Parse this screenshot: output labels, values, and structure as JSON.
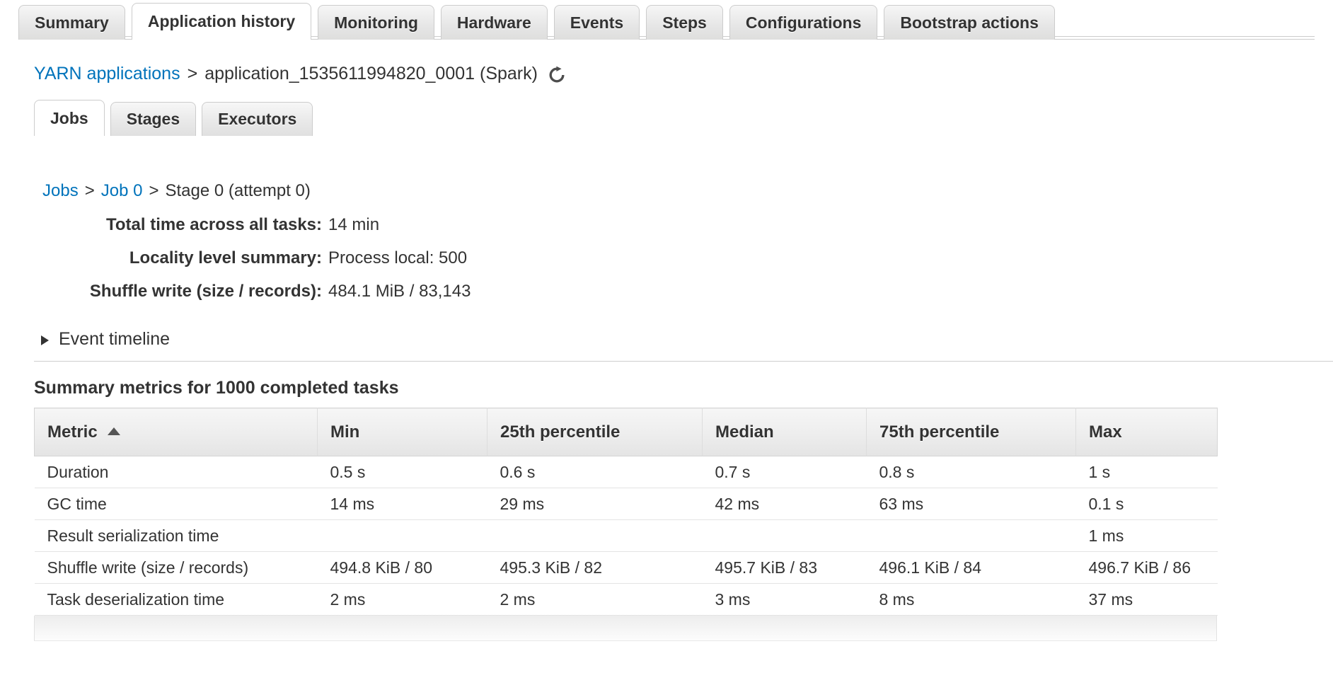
{
  "outer_tabs": [
    {
      "label": "Summary",
      "active": false
    },
    {
      "label": "Application history",
      "active": true
    },
    {
      "label": "Monitoring",
      "active": false
    },
    {
      "label": "Hardware",
      "active": false
    },
    {
      "label": "Events",
      "active": false
    },
    {
      "label": "Steps",
      "active": false
    },
    {
      "label": "Configurations",
      "active": false
    },
    {
      "label": "Bootstrap actions",
      "active": false
    }
  ],
  "app_breadcrumb": {
    "link_label": "YARN applications",
    "separator": ">",
    "current": "application_1535611994820_0001 (Spark)",
    "refresh_icon": "refresh-icon"
  },
  "inner_tabs": [
    {
      "label": "Jobs",
      "active": true
    },
    {
      "label": "Stages",
      "active": false
    },
    {
      "label": "Executors",
      "active": false
    }
  ],
  "job_breadcrumb": {
    "items": [
      {
        "label": "Jobs",
        "link": true
      },
      {
        "label": "Job 0",
        "link": true
      },
      {
        "label": "Stage 0 (attempt 0)",
        "link": false
      }
    ],
    "separator": ">"
  },
  "details": [
    {
      "label": "Total time across all tasks:",
      "value": "14 min"
    },
    {
      "label": "Locality level summary:",
      "value": "Process local: 500"
    },
    {
      "label": "Shuffle write (size / records):",
      "value": "484.1 MiB / 83,143"
    }
  ],
  "event_timeline": {
    "label": "Event timeline",
    "expand_icon": "triangle-right-icon",
    "expanded": false
  },
  "summary_heading": "Summary metrics for 1000 completed tasks",
  "metrics_table": {
    "sort_column": "Metric",
    "sort_direction": "asc",
    "sort_icon": "sort-ascending-icon",
    "columns": [
      "Metric",
      "Min",
      "25th percentile",
      "Median",
      "75th percentile",
      "Max"
    ],
    "rows": [
      {
        "metric": "Duration",
        "min": "0.5 s",
        "p25": "0.6 s",
        "median": "0.7 s",
        "p75": "0.8 s",
        "max": "1 s"
      },
      {
        "metric": "GC time",
        "min": "14 ms",
        "p25": "29 ms",
        "median": "42 ms",
        "p75": "63 ms",
        "max": "0.1 s"
      },
      {
        "metric": "Result serialization time",
        "min": "",
        "p25": "",
        "median": "",
        "p75": "",
        "max": "1 ms"
      },
      {
        "metric": "Shuffle write (size / records)",
        "min": "494.8 KiB / 80",
        "p25": "495.3 KiB / 82",
        "median": "495.7 KiB / 83",
        "p75": "496.1 KiB / 84",
        "max": "496.7 KiB / 86"
      },
      {
        "metric": "Task deserialization time",
        "min": "2 ms",
        "p25": "2 ms",
        "median": "3 ms",
        "p75": "8 ms",
        "max": "37 ms"
      }
    ]
  },
  "colors": {
    "link": "#0073bb",
    "text": "#333333",
    "tab_border": "#cccccc",
    "table_border": "#d5d5d5",
    "row_divider": "#e4e4e4"
  }
}
